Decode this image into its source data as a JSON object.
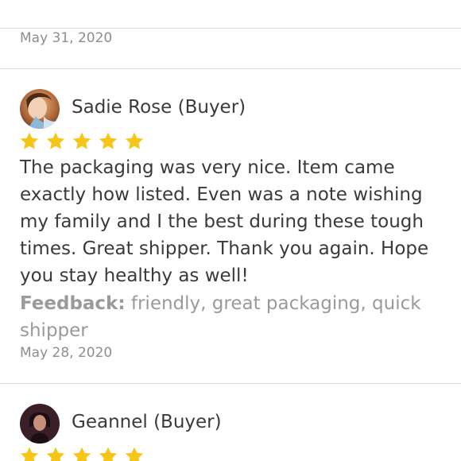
{
  "colors": {
    "star": "#F5C518",
    "divider": "#DCDCDC",
    "muted_text": "#8E8E8E",
    "body_text": "#3A3A3A"
  },
  "top_review": {
    "date": "May 31, 2020"
  },
  "reviews": [
    {
      "name": "Sadie Rose (Buyer)",
      "rating": 5,
      "text": "The packaging was very nice. Item came exactly how listed. Even was a note wishing my family and I the best during these tough times. Great shipper. Thank you again. Hope you stay healthy as well!",
      "feedback_label": "Feedback:",
      "feedback_value": " friendly, great packaging, quick shipper",
      "date": "May 28, 2020"
    },
    {
      "name": "Geannel (Buyer)",
      "rating": 5
    }
  ],
  "icons": {
    "star": "star-icon",
    "avatar": "avatar"
  }
}
